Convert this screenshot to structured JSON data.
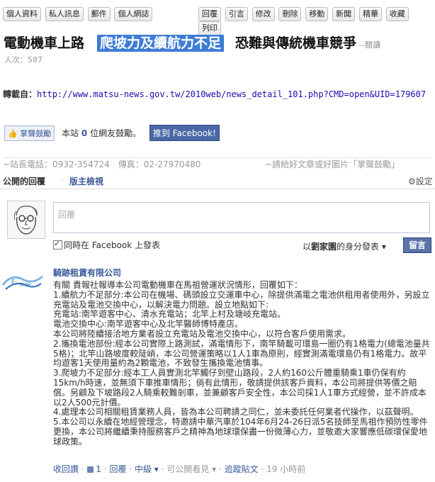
{
  "toolbar": {
    "left": [
      "個人資料",
      "私人訊息",
      "郵件",
      "個人網誌"
    ],
    "right": [
      "回覆",
      "引言",
      "修改",
      "刪除",
      "移動",
      "新聞",
      "精華",
      "收藏",
      "列印"
    ]
  },
  "article": {
    "title_left": "電動機車上路",
    "title_highlight": "爬坡力及續航力不足",
    "title_right": "恐難與傳統機車競爭",
    "read_tail": "--閱讀",
    "views": "人次：587",
    "repost_label": "轉載自：",
    "repost_url": "http://www.matsu-news.gov.tw/2010web/news_detail_101.php?CMD=open&UID=179607"
  },
  "like_bar": {
    "like_label": "掌聲鼓勵",
    "text_prefix": "本站",
    "count": "0",
    "text_suffix": "位網友鼓勵。",
    "share_label": "推到 Facebook!"
  },
  "contact": {
    "left": "~站長電話：0932-354724　傳真：02-27970480",
    "right": "~請給好文章或好圖片「掌聲鼓勵」"
  },
  "comments_tabs": {
    "public": "公開的回覆",
    "separator": "·",
    "admin": "版主檢視",
    "settings": "設定"
  },
  "comment_box": {
    "placeholder": "回覆",
    "also_post": "同時在 Facebook 上發表",
    "as_prefix": "以",
    "user": "劉家園",
    "as_suffix": "的身分發表 ▾",
    "submit": "留言"
  },
  "post": {
    "author": "騎跡租賃有限公司",
    "paragraphs": [
      "有關 貴報社報導本公司電動機車在馬祖營運狀況情形，回覆如下：",
      "1.續航力不足部分:本公司在機場、碼頭設立交運車中心，除提供滿電之電池供租用者使用外，另設立充電站及電池交換中心，以解決電力問題。設立地點如下:",
      "充電站:南竿遊客中心、清水充電站；北竿上村及塘岐充電站。",
      "電池交換中心:南竿遊客中心及北竿醫師博特產店。",
      "本公司將陸續接洽地方業者設立充電站及電池交換中心，以符合客戶使用需求。",
      "2.攜換電池部份:經本公司實際上路測試，滿電情形下，南竿騎載可環島一圈仍有1格電力(總電池量共5格)；北竿山路坡度較陡峭，本公司營運策略以1人1車為原則，經實測滿電環島仍有1格電力。故平均遊客1天使用量約為2顆電池，不致發生攜換電池情事。",
      "3.爬坡力不足部分:經本工人員實測北竿觸仔到壁山路段，2人約160公斤體重騎乘1車仍保有約15km/h時速，並無須下車推車情形；倘有此情形，敬請提供該客戶資料，本公司將提供等價之賠償。另顧及下坡路段2人騎乘較難剎車，並兼顧客戶安全性，本公司採1人1車方式經營，並不許成本以2人500元計價。",
      "4.處理本公司相關租賃業務人員，皆為本公司聘請之同仁，並未委託任何業者代操作，以茲聲明。",
      "5.本公司以永續在地經營理念，特邀請中華汽車於104年6月24-26日派5名技師至馬祖作預防性零件更換，本公司將繼續秉持服務客戶之精神為地球環保盡一份微薄心力，並敬邀大家響應低碳環保愛地球政策。"
    ],
    "actions": {
      "recall": "收回讚",
      "like_count": "1",
      "reply": "回覆",
      "mid": "中級 ▾",
      "visible": "可公開看見 ▾",
      "follow": "追蹤貼文",
      "time": "19 小時前"
    }
  }
}
